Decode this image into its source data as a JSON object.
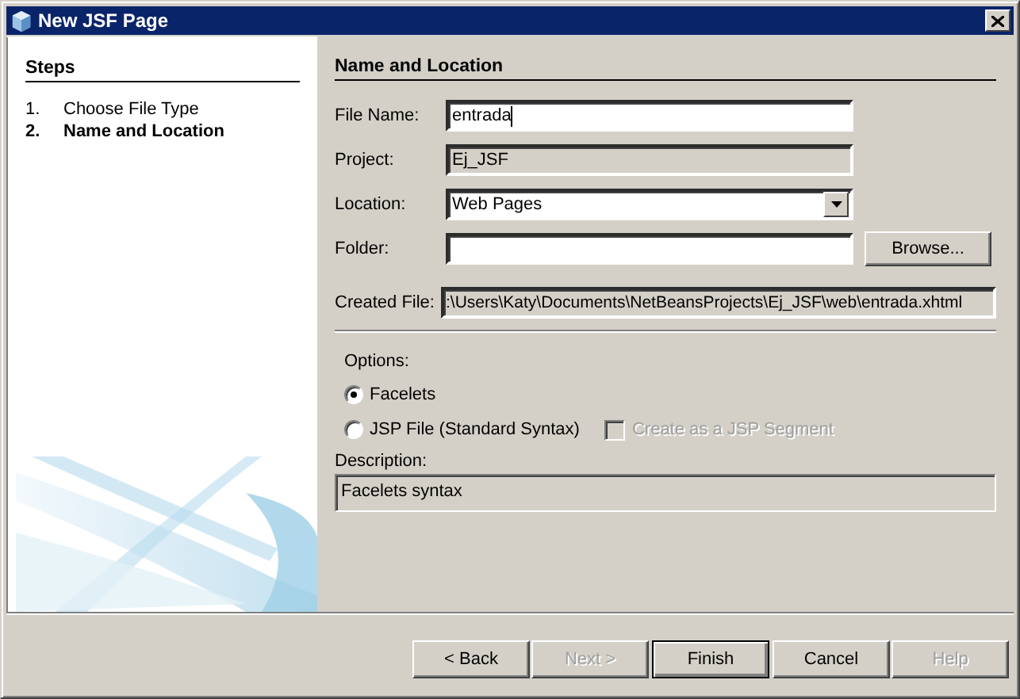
{
  "window": {
    "title": "New JSF Page"
  },
  "steps": {
    "title": "Steps",
    "items": [
      {
        "number": "1.",
        "label": "Choose File Type",
        "selected": false
      },
      {
        "number": "2.",
        "label": "Name and Location",
        "selected": true
      }
    ]
  },
  "panel": {
    "title": "Name and Location",
    "fields": [
      {
        "kind": "text",
        "label": "File Name:",
        "value": "entrada",
        "disabled": false
      },
      {
        "kind": "text",
        "label": "Project:",
        "value": "Ej_JSF",
        "disabled": true
      },
      {
        "kind": "combo",
        "label": "Location:",
        "value": "Web Pages"
      },
      {
        "kind": "browse",
        "label": "Folder:",
        "button": "Browse..."
      },
      {
        "kind": "path",
        "label": "Created File:",
        "value": ":\\Users\\Katy\\Documents\\NetBeansProjects\\Ej_JSF\\web\\entrada.xhtml"
      }
    ],
    "options": {
      "label": "Options:",
      "radios": [
        {
          "label": "Facelets",
          "selected": true
        },
        {
          "label": "JSP File (Standard Syntax)",
          "selected": false
        }
      ],
      "checkbox": {
        "label": "Create as a JSP Segment",
        "checked": false,
        "disabled": true
      }
    },
    "description": {
      "label": "Description:",
      "value": "Facelets syntax"
    }
  },
  "buttons": [
    {
      "label": "< Back",
      "disabled": false,
      "default": false
    },
    {
      "label": "Next >",
      "disabled": true,
      "default": false
    },
    {
      "label": "Finish",
      "disabled": false,
      "default": true
    },
    {
      "label": "Cancel",
      "disabled": false,
      "default": false
    },
    {
      "label": "Help",
      "disabled": true,
      "default": false
    }
  ]
}
